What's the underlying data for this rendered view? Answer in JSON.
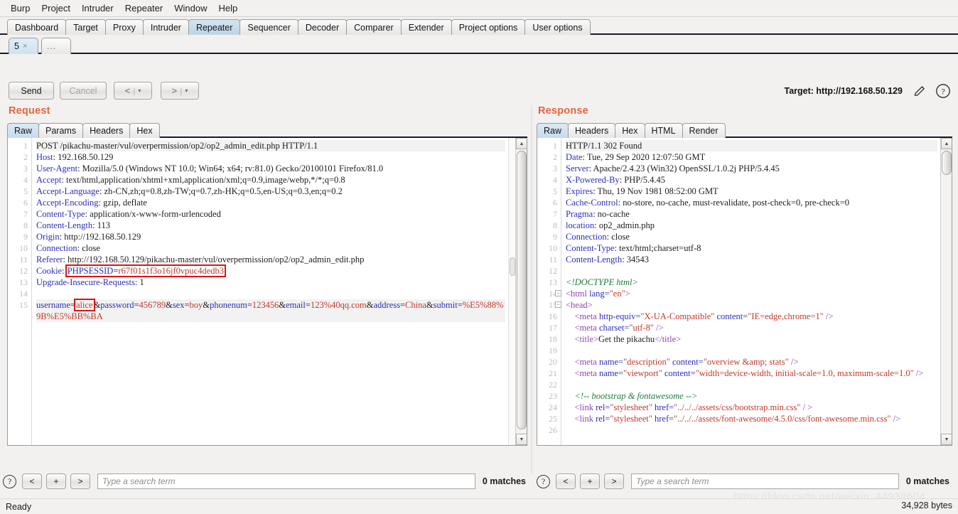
{
  "menubar": {
    "items": [
      "Burp",
      "Project",
      "Intruder",
      "Repeater",
      "Window",
      "Help"
    ]
  },
  "main_tabs": {
    "items": [
      "Dashboard",
      "Target",
      "Proxy",
      "Intruder",
      "Repeater",
      "Sequencer",
      "Decoder",
      "Comparer",
      "Extender",
      "Project options",
      "User options"
    ],
    "active": "Repeater"
  },
  "sub_tabs": {
    "items": [
      {
        "label": "5",
        "close": "×",
        "active": true
      },
      {
        "label": "...",
        "close": "",
        "active": false
      }
    ]
  },
  "toolbar": {
    "send_label": "Send",
    "cancel_label": "Cancel",
    "back_glyph": "<",
    "forward_glyph": ">",
    "split_glyph": "|",
    "caret_glyph": "▾",
    "target_label": "Target: http://192.168.50.129",
    "pencil_icon": "pencil-icon",
    "help_icon": "help-icon"
  },
  "request": {
    "title": "Request",
    "tabs": [
      "Raw",
      "Params",
      "Headers",
      "Hex"
    ],
    "active_tab": "Raw",
    "line_numbers": [
      "1",
      "2",
      "3",
      "4",
      "5",
      "6",
      "7",
      "8",
      "9",
      "10",
      "11",
      "12",
      "13",
      "14",
      "15"
    ],
    "lines": [
      {
        "n": 1,
        "highlight": true,
        "parts": [
          {
            "t": "POST /pikachu-master/vul/overpermission/op2/op2_admin_edit.php HTTP/1.1",
            "c": "txt"
          }
        ]
      },
      {
        "n": 2,
        "parts": [
          {
            "t": "Host",
            "c": "hdr"
          },
          {
            "t": ": 192.168.50.129",
            "c": "val"
          }
        ]
      },
      {
        "n": 3,
        "parts": [
          {
            "t": "User-Agent",
            "c": "hdr"
          },
          {
            "t": ": Mozilla/5.0 (Windows NT 10.0; Win64; x64; rv:81.0) Gecko/20100101 Firefox/81.0",
            "c": "val"
          }
        ]
      },
      {
        "n": 4,
        "parts": [
          {
            "t": "Accept",
            "c": "hdr"
          },
          {
            "t": ": text/html,application/xhtml+xml,application/xml;q=0.9,image/webp,*/*;q=0.8",
            "c": "val"
          }
        ]
      },
      {
        "n": 5,
        "parts": [
          {
            "t": "Accept-Language",
            "c": "hdr"
          },
          {
            "t": ": zh-CN,zh;q=0.8,zh-TW;q=0.7,zh-HK;q=0.5,en-US;q=0.3,en;q=0.2",
            "c": "val"
          }
        ]
      },
      {
        "n": 6,
        "parts": [
          {
            "t": "Accept-Encoding",
            "c": "hdr"
          },
          {
            "t": ": gzip, deflate",
            "c": "val"
          }
        ]
      },
      {
        "n": 7,
        "parts": [
          {
            "t": "Content-Type",
            "c": "hdr"
          },
          {
            "t": ": application/x-www-form-urlencoded",
            "c": "val"
          }
        ]
      },
      {
        "n": 8,
        "parts": [
          {
            "t": "Content-Length",
            "c": "hdr"
          },
          {
            "t": ": 113",
            "c": "val"
          }
        ]
      },
      {
        "n": 9,
        "parts": [
          {
            "t": "Origin",
            "c": "hdr"
          },
          {
            "t": ": http://192.168.50.129",
            "c": "val"
          }
        ]
      },
      {
        "n": 10,
        "parts": [
          {
            "t": "Connection",
            "c": "hdr"
          },
          {
            "t": ": close",
            "c": "val"
          }
        ]
      },
      {
        "n": 11,
        "parts": [
          {
            "t": "Referer",
            "c": "hdr"
          },
          {
            "t": ": http://192.168.50.129/pikachu-master/vul/overpermission/op2/op2_admin_edit.php",
            "c": "val"
          }
        ]
      },
      {
        "n": 12,
        "parts": [
          {
            "t": "Cookie",
            "c": "hdr"
          },
          {
            "t": ": ",
            "c": "val"
          },
          {
            "t": "PHPSESSID",
            "c": "param",
            "box_start": true
          },
          {
            "t": "=",
            "c": "val"
          },
          {
            "t": "r67f01s1f3o16jf0vpuc4dedb3",
            "c": "pval",
            "box_end": true
          }
        ]
      },
      {
        "n": 13,
        "parts": [
          {
            "t": "Upgrade-Insecure-Requests",
            "c": "hdr"
          },
          {
            "t": ": 1",
            "c": "val"
          }
        ]
      },
      {
        "n": 14,
        "parts": [
          {
            "t": "",
            "c": "txt"
          }
        ]
      },
      {
        "n": 15,
        "highlight": true,
        "parts": [
          {
            "t": "username",
            "c": "param"
          },
          {
            "t": "=",
            "c": "val"
          },
          {
            "t": "alice",
            "c": "pval",
            "boxed": true
          },
          {
            "t": "&",
            "c": "val"
          },
          {
            "t": "password",
            "c": "param"
          },
          {
            "t": "=",
            "c": "val"
          },
          {
            "t": "456789",
            "c": "pval"
          },
          {
            "t": "&",
            "c": "val"
          },
          {
            "t": "sex",
            "c": "param"
          },
          {
            "t": "=",
            "c": "val"
          },
          {
            "t": "boy",
            "c": "pval"
          },
          {
            "t": "&",
            "c": "val"
          },
          {
            "t": "phonenum",
            "c": "param"
          },
          {
            "t": "=",
            "c": "val"
          },
          {
            "t": "123456",
            "c": "pval"
          },
          {
            "t": "&",
            "c": "val"
          },
          {
            "t": "email",
            "c": "param"
          },
          {
            "t": "=",
            "c": "val"
          },
          {
            "t": "123%40qq.com",
            "c": "pval"
          },
          {
            "t": "&",
            "c": "val"
          },
          {
            "t": "address",
            "c": "param"
          },
          {
            "t": "=",
            "c": "val"
          },
          {
            "t": "China",
            "c": "pval"
          },
          {
            "t": "&",
            "c": "val"
          },
          {
            "t": "submit",
            "c": "param"
          },
          {
            "t": "=",
            "c": "val"
          },
          {
            "t": "%E5%88%9B%E5%BB%BA",
            "c": "pval"
          }
        ]
      }
    ],
    "search": {
      "help_glyph": "?",
      "prev_label": "<",
      "plus_label": "+",
      "next_label": ">",
      "placeholder": "Type a search term",
      "value": "",
      "matches": "0 matches"
    }
  },
  "response": {
    "title": "Response",
    "tabs": [
      "Raw",
      "Headers",
      "Hex",
      "HTML",
      "Render"
    ],
    "active_tab": "Raw",
    "lines": [
      {
        "n": 1,
        "highlight": true,
        "parts": [
          {
            "t": "HTTP/1.1 302 Found",
            "c": "txt"
          }
        ]
      },
      {
        "n": 2,
        "parts": [
          {
            "t": "Date",
            "c": "hdr"
          },
          {
            "t": ": Tue, 29 Sep 2020 12:07:50 GMT",
            "c": "val"
          }
        ]
      },
      {
        "n": 3,
        "parts": [
          {
            "t": "Server",
            "c": "hdr"
          },
          {
            "t": ": Apache/2.4.23 (Win32) OpenSSL/1.0.2j PHP/5.4.45",
            "c": "val"
          }
        ]
      },
      {
        "n": 4,
        "parts": [
          {
            "t": "X-Powered-By",
            "c": "hdr"
          },
          {
            "t": ": PHP/5.4.45",
            "c": "val"
          }
        ]
      },
      {
        "n": 5,
        "parts": [
          {
            "t": "Expires",
            "c": "hdr"
          },
          {
            "t": ": Thu, 19 Nov 1981 08:52:00 GMT",
            "c": "val"
          }
        ]
      },
      {
        "n": 6,
        "parts": [
          {
            "t": "Cache-Control",
            "c": "hdr"
          },
          {
            "t": ": no-store, no-cache, must-revalidate, post-check=0, pre-check=0",
            "c": "val"
          }
        ]
      },
      {
        "n": 7,
        "parts": [
          {
            "t": "Pragma",
            "c": "hdr"
          },
          {
            "t": ": no-cache",
            "c": "val"
          }
        ]
      },
      {
        "n": 8,
        "parts": [
          {
            "t": "location",
            "c": "hdr"
          },
          {
            "t": ": op2_admin.php",
            "c": "val"
          }
        ]
      },
      {
        "n": 9,
        "parts": [
          {
            "t": "Connection",
            "c": "hdr"
          },
          {
            "t": ": close",
            "c": "val"
          }
        ]
      },
      {
        "n": 10,
        "parts": [
          {
            "t": "Content-Type",
            "c": "hdr"
          },
          {
            "t": ": text/html;charset=utf-8",
            "c": "val"
          }
        ]
      },
      {
        "n": 11,
        "parts": [
          {
            "t": "Content-Length",
            "c": "hdr"
          },
          {
            "t": ": 34543",
            "c": "val"
          }
        ]
      },
      {
        "n": 12,
        "parts": [
          {
            "t": "",
            "c": "txt"
          }
        ]
      },
      {
        "n": 13,
        "parts": [
          {
            "t": "<!DOCTYPE html>",
            "c": "cmt"
          }
        ]
      },
      {
        "n": 14,
        "fold": true,
        "parts": [
          {
            "t": "<html ",
            "c": "tag"
          },
          {
            "t": "lang=",
            "c": "attr"
          },
          {
            "t": "\"en\"",
            "c": "astr"
          },
          {
            "t": ">",
            "c": "tag"
          }
        ]
      },
      {
        "n": 15,
        "fold": true,
        "parts": [
          {
            "t": "<head>",
            "c": "tag"
          }
        ]
      },
      {
        "n": 16,
        "parts": [
          {
            "t": "    <meta ",
            "c": "tag"
          },
          {
            "t": "http-equiv=",
            "c": "attr"
          },
          {
            "t": "\"X-UA-Compatible\"",
            "c": "astr"
          },
          {
            "t": " content=",
            "c": "attr"
          },
          {
            "t": "\"IE=edge,chrome=1\"",
            "c": "astr"
          },
          {
            "t": " />",
            "c": "tag"
          }
        ]
      },
      {
        "n": 17,
        "parts": [
          {
            "t": "    <meta ",
            "c": "tag"
          },
          {
            "t": "charset=",
            "c": "attr"
          },
          {
            "t": "\"utf-8\"",
            "c": "astr"
          },
          {
            "t": " />",
            "c": "tag"
          }
        ]
      },
      {
        "n": 18,
        "parts": [
          {
            "t": "    <title>",
            "c": "tag"
          },
          {
            "t": "Get the pikachu",
            "c": "txt"
          },
          {
            "t": "</title>",
            "c": "tag"
          }
        ]
      },
      {
        "n": 19,
        "parts": [
          {
            "t": "",
            "c": "txt"
          }
        ]
      },
      {
        "n": 20,
        "parts": [
          {
            "t": "    <meta ",
            "c": "tag"
          },
          {
            "t": "name=",
            "c": "attr"
          },
          {
            "t": "\"description\"",
            "c": "astr"
          },
          {
            "t": " content=",
            "c": "attr"
          },
          {
            "t": "\"overview &amp; stats\"",
            "c": "astr"
          },
          {
            "t": " />",
            "c": "tag"
          }
        ]
      },
      {
        "n": 21,
        "parts": [
          {
            "t": "    <meta ",
            "c": "tag"
          },
          {
            "t": "name=",
            "c": "attr"
          },
          {
            "t": "\"viewport\"",
            "c": "astr"
          },
          {
            "t": " content=",
            "c": "attr"
          },
          {
            "t": "\"width=device-width, initial-scale=1.0, maximum-scale=1.0\"",
            "c": "astr"
          },
          {
            "t": " />",
            "c": "tag"
          }
        ]
      },
      {
        "n": 22,
        "parts": [
          {
            "t": "",
            "c": "txt"
          }
        ]
      },
      {
        "n": 23,
        "parts": [
          {
            "t": "    <!-- bootstrap & fontawesome -->",
            "c": "cmt"
          }
        ]
      },
      {
        "n": 24,
        "parts": [
          {
            "t": "    <link ",
            "c": "tag"
          },
          {
            "t": "rel=",
            "c": "attr"
          },
          {
            "t": "\"stylesheet\"",
            "c": "astr"
          },
          {
            "t": " href=",
            "c": "attr"
          },
          {
            "t": "\"../../../assets/css/bootstrap.min.css\"",
            "c": "astr"
          },
          {
            "t": " / >",
            "c": "tag"
          }
        ]
      },
      {
        "n": 25,
        "parts": [
          {
            "t": "    <link ",
            "c": "tag"
          },
          {
            "t": "rel=",
            "c": "attr"
          },
          {
            "t": "\"stylesheet\"",
            "c": "astr"
          },
          {
            "t": " href=",
            "c": "attr"
          },
          {
            "t": "\"../../../assets/font-awesome/4.5.0/css/font-awesome.min.css\"",
            "c": "astr"
          },
          {
            "t": " />",
            "c": "tag"
          }
        ]
      },
      {
        "n": 26,
        "parts": [
          {
            "t": "",
            "c": "txt"
          }
        ]
      }
    ],
    "search": {
      "help_glyph": "?",
      "prev_label": "<",
      "plus_label": "+",
      "next_label": ">",
      "placeholder": "Type a search term",
      "value": "",
      "matches": "0 matches"
    }
  },
  "statusbar": {
    "status": "Ready",
    "bytes": "34,928 bytes",
    "watermark": "https://blog.csdn.net/weixin_44938604"
  },
  "colors": {
    "accent_orange": "#e8643c",
    "header_blue": "#2b2fb5",
    "value_red": "#c0392b",
    "tag_purple": "#8e44ad",
    "comment_green": "#1f7a3d",
    "highlight_box": "#d81616",
    "active_tab_blue": "#c6dbed"
  }
}
